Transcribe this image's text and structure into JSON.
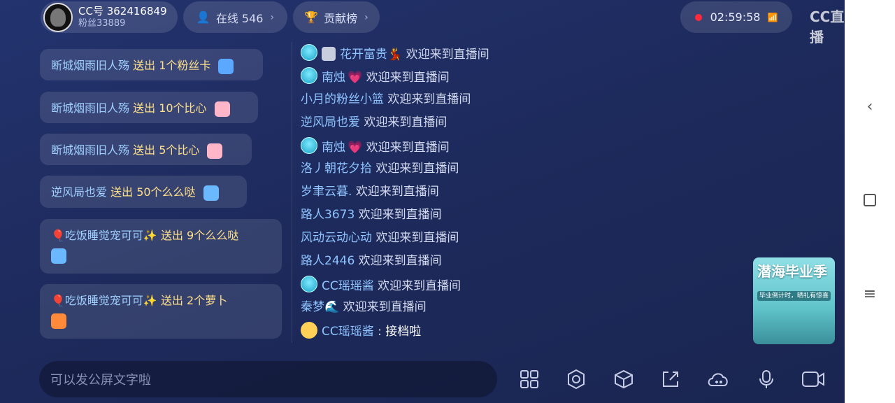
{
  "header": {
    "host_id": "CC号 362416849",
    "host_fans": "粉丝33889",
    "online": "在线 546",
    "rank": "贡献榜",
    "timer": "02:59:58",
    "logo": "CC直播"
  },
  "gifts": [
    {
      "name": "断城烟雨旧人殇",
      "action": "送出 1个粉丝卡",
      "icon": "fan-card-icon"
    },
    {
      "name": "断城烟雨旧人殇",
      "action": "送出 10个比心",
      "icon": "heart-hand-icon"
    },
    {
      "name": "断城烟雨旧人殇",
      "action": "送出 5个比心",
      "icon": "heart-hand-icon"
    },
    {
      "name": "逆风局也爱",
      "action": "送出 50个么么哒",
      "icon": "kiss-icon"
    },
    {
      "name": "🎈吃饭睡觉宠可可✨",
      "action": "送出 9个么么哒",
      "icon": "kiss-icon"
    },
    {
      "name": "🎈吃饭睡觉宠可可✨",
      "action": "送出 2个萝卜",
      "icon": "carrot-icon"
    }
  ],
  "chat": [
    {
      "name": "花开富贵",
      "msg": "欢迎来到直播间",
      "badge": true,
      "shield": true,
      "suffix": "💃"
    },
    {
      "name": "南烛",
      "msg": "欢迎来到直播间",
      "badge": true,
      "suffix": "💗"
    },
    {
      "name": "小月的粉丝小篮",
      "msg": "欢迎来到直播间"
    },
    {
      "name": "逆风局也爱",
      "msg": "欢迎来到直播间"
    },
    {
      "name": "南烛",
      "msg": "欢迎来到直播间",
      "badge": true,
      "suffix": "💗"
    },
    {
      "name": "洛丿朝花夕拾",
      "msg": "欢迎来到直播间"
    },
    {
      "name": "岁聿云暮.",
      "msg": "欢迎来到直播间"
    },
    {
      "name": "路人3673",
      "msg": "欢迎来到直播间"
    },
    {
      "name": "风动云动心动",
      "msg": "欢迎来到直播间"
    },
    {
      "name": "路人2446",
      "msg": "欢迎来到直播间"
    },
    {
      "name": "CC瑶瑶酱",
      "msg": "欢迎来到直播间",
      "badge": true
    },
    {
      "name": "秦梦",
      "msg": "欢迎来到直播间",
      "suffix": "🌊"
    },
    {
      "name": "CC瑶瑶酱",
      "msg": "接档啦",
      "face": true
    }
  ],
  "ad": {
    "title": "潜海毕业季",
    "subtitle": "毕业倒计时，晒礼有惊喜"
  },
  "input": {
    "placeholder": "可以发公屏文字啦"
  },
  "tools": [
    "apps-icon",
    "settings-icon",
    "cube-icon",
    "share-icon",
    "cloud-game-icon",
    "microphone-icon",
    "video-icon"
  ],
  "colors": {
    "background": "#1f2c60",
    "gift_name": "#9fd0ff",
    "gift_action": "#ffe08a",
    "chat_name": "#8fc4ff",
    "record": "#ff2a3c"
  }
}
